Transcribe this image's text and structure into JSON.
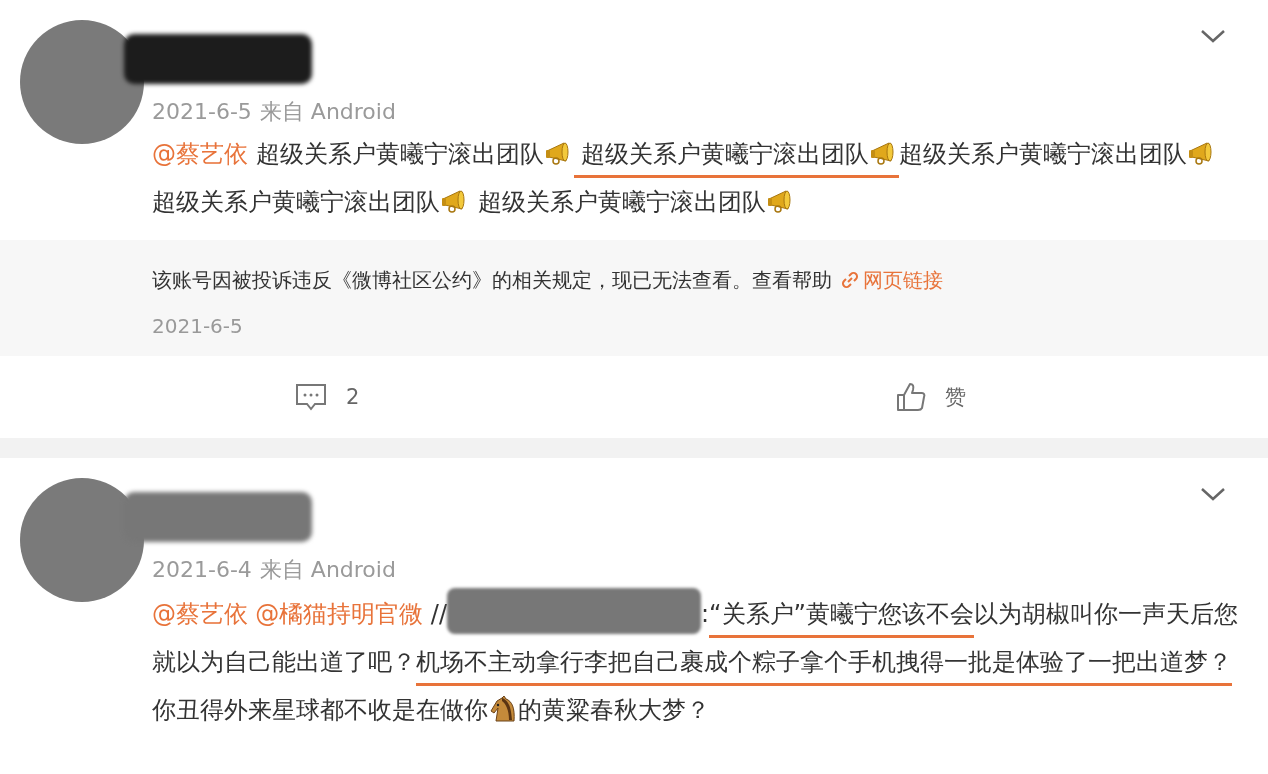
{
  "posts": [
    {
      "author": {
        "redacted": true,
        "color": "#1c1c1c"
      },
      "timestamp": "2021-6-5",
      "source": "来自 Android",
      "body": [
        {
          "kind": "mention",
          "text": "@蔡艺依"
        },
        {
          "kind": "text",
          "text": " 超级关系户黄曦宁滚出团队",
          "underlined": false
        },
        {
          "kind": "megaphone",
          "underlined": false
        },
        {
          "kind": "text",
          "text": " 超级关系户黄曦宁滚出团队",
          "underlined": true
        },
        {
          "kind": "megaphone",
          "underlined": true
        },
        {
          "kind": "text",
          "text": "超级关系户黄曦宁滚出团队",
          "underlined": false
        },
        {
          "kind": "megaphone",
          "underlined": false
        },
        {
          "kind": "text",
          "text": " 超级关系户黄曦宁滚出团队",
          "underlined": false
        },
        {
          "kind": "megaphone",
          "underlined": false
        },
        {
          "kind": "text",
          "text": " 超级关系户黄曦宁滚出团队",
          "underlined": false
        },
        {
          "kind": "megaphone",
          "underlined": false
        }
      ],
      "quote": {
        "text": "该账号因被投诉违反《微博社区公约》的相关规定，现已无法查看。查看帮助",
        "link": "网页链接",
        "date": "2021-6-5"
      },
      "actions": {
        "comments": "2",
        "like": "赞"
      }
    },
    {
      "author": {
        "redacted": true,
        "color": "#777777"
      },
      "timestamp": "2021-6-4",
      "source": "来自 Android",
      "body": [
        {
          "kind": "mention",
          "text": "@蔡艺依"
        },
        {
          "kind": "mention",
          "text": "@橘猫持明官微"
        },
        {
          "kind": "text",
          "text": " //",
          "underlined": false
        },
        {
          "kind": "redacted"
        },
        {
          "kind": "text",
          "text": ":",
          "underlined": false
        },
        {
          "kind": "text",
          "text": "“关系户”黄曦宁您该不会",
          "underlined": true
        },
        {
          "kind": "text",
          "text": "以为胡椒叫你一声天后您就以为自己能出道了吧？",
          "underlined": false
        },
        {
          "kind": "text",
          "text": "机场不主动拿行李把自己裹成个粽子拿个手机拽得一批是体验了一把出道梦？",
          "underlined": true
        },
        {
          "kind": "text",
          "text": "你丑得外来星球都不收是在做你",
          "underlined": false
        },
        {
          "kind": "horse",
          "underlined": false
        },
        {
          "kind": "text",
          "text": "的黄粱春秋大梦？",
          "underlined": false
        }
      ]
    }
  ]
}
